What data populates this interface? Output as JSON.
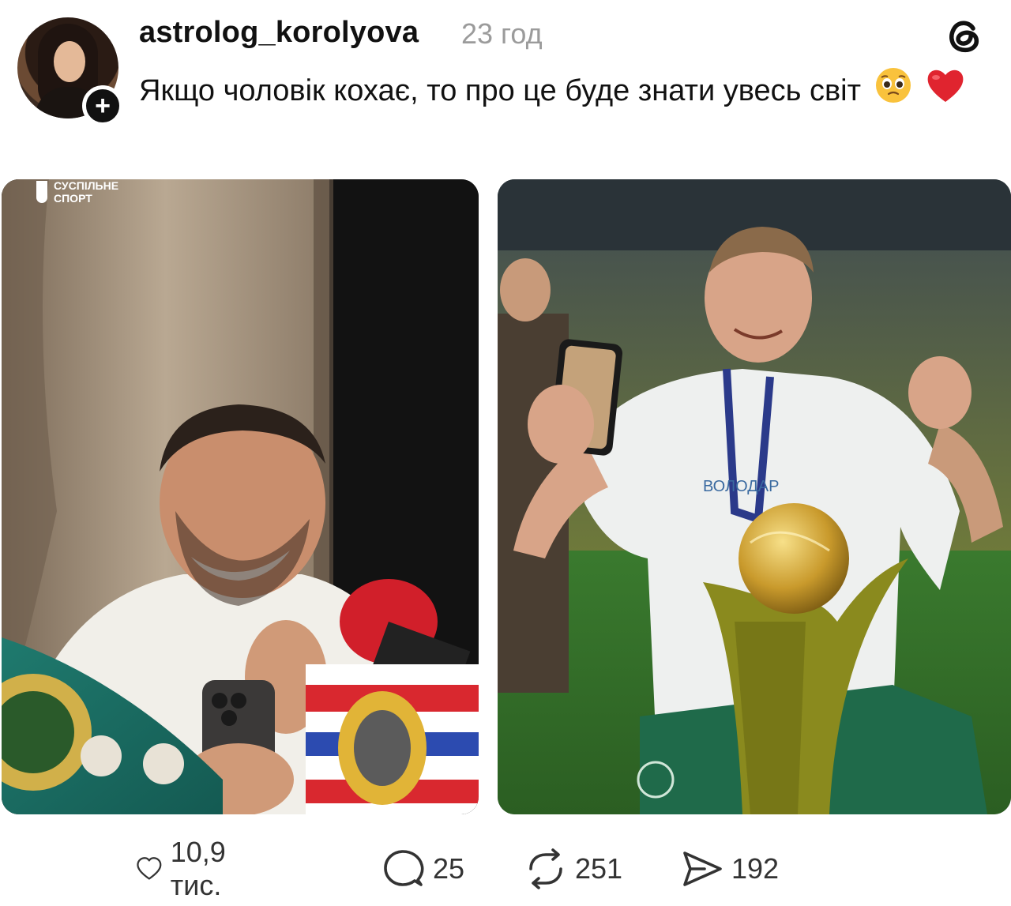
{
  "post": {
    "username": "astrolog_korolyova",
    "time": "23 год",
    "text": "Якщо чоловік кохає, то про це буде знати увесь світ",
    "emojis": [
      "🥹",
      "❤️"
    ],
    "follow_badge": "+"
  },
  "icons": {
    "platform": "threads-icon",
    "follow": "plus-icon",
    "like": "heart-icon",
    "reply": "comment-bubble-icon",
    "repost": "repost-arrows-icon",
    "share": "send-icon"
  },
  "media": {
    "left_watermark": [
      "СУСПІЛЬНЕ",
      "СПОРТ"
    ],
    "right_shirt_text": "ВОЛОДАР"
  },
  "actions": {
    "likes": "10,9 тис.",
    "replies": "25",
    "reposts": "251",
    "shares": "192"
  },
  "colors": {
    "text": "#111111",
    "muted": "#9b9b9b",
    "counts": "#333333",
    "emoji_heart": "#e0242f"
  }
}
